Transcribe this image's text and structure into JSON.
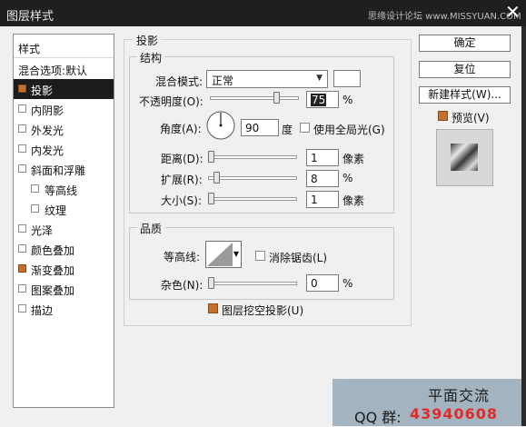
{
  "window": {
    "title": "图层样式",
    "watermark": "思缘设计论坛 www.MISSYUAN.COM",
    "close_glyph": "✕"
  },
  "style_list": {
    "header": "样式",
    "items": [
      {
        "label": "混合选项:默认",
        "checkbox": false,
        "checked": false,
        "selected": false
      },
      {
        "label": "投影",
        "checkbox": true,
        "checked": true,
        "selected": true
      },
      {
        "label": "内阴影",
        "checkbox": true,
        "checked": false,
        "selected": false
      },
      {
        "label": "外发光",
        "checkbox": true,
        "checked": false,
        "selected": false
      },
      {
        "label": "内发光",
        "checkbox": true,
        "checked": false,
        "selected": false
      },
      {
        "label": "斜面和浮雕",
        "checkbox": true,
        "checked": false,
        "selected": false
      },
      {
        "label": "等高线",
        "checkbox": true,
        "checked": false,
        "selected": false
      },
      {
        "label": "纹理",
        "checkbox": true,
        "checked": false,
        "selected": false
      },
      {
        "label": "光泽",
        "checkbox": true,
        "checked": false,
        "selected": false
      },
      {
        "label": "颜色叠加",
        "checkbox": true,
        "checked": false,
        "selected": false
      },
      {
        "label": "渐变叠加",
        "checkbox": true,
        "checked": true,
        "selected": false
      },
      {
        "label": "图案叠加",
        "checkbox": true,
        "checked": false,
        "selected": false
      },
      {
        "label": "描边",
        "checkbox": true,
        "checked": false,
        "selected": false
      }
    ]
  },
  "drop_shadow": {
    "section_title": "投影",
    "structure": {
      "title": "结构",
      "blend_mode_label": "混合模式:",
      "blend_mode_value": "正常",
      "opacity_label": "不透明度(O):",
      "opacity_value": "75",
      "opacity_unit": "%",
      "angle_label": "角度(A):",
      "angle_value": "90",
      "angle_unit": "度",
      "global_light_label": "使用全局光(G)",
      "distance_label": "距离(D):",
      "distance_value": "1",
      "distance_unit": "像素",
      "spread_label": "扩展(R):",
      "spread_value": "8",
      "spread_unit": "%",
      "size_label": "大小(S):",
      "size_value": "1",
      "size_unit": "像素"
    },
    "quality": {
      "title": "品质",
      "contour_label": "等高线:",
      "anti_alias_label": "消除锯齿(L)",
      "noise_label": "杂色(N):",
      "noise_value": "0",
      "noise_unit": "%"
    },
    "knockout_label": "图层挖空投影(U)"
  },
  "buttons": {
    "ok": "确定",
    "reset": "复位",
    "new_style": "新建样式(W)...",
    "preview_label": "预览(V)"
  },
  "overlay": {
    "line1": "平面交流",
    "qq_label": "QQ 群:",
    "qq_number": "43940608"
  },
  "colors": {
    "accent": "#c2712e",
    "titlebar": "#1f1f1f",
    "selected_row": "#1c1c1c",
    "qq_number": "#e02020"
  }
}
